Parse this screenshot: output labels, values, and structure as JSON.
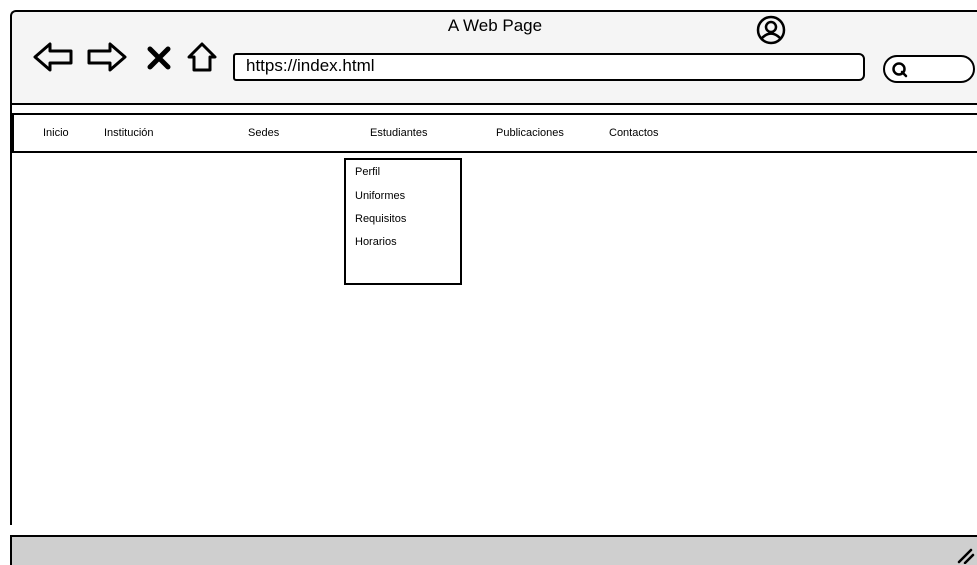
{
  "window": {
    "title": "A Web Page"
  },
  "toolbar": {
    "back_icon": "arrow-left-icon",
    "forward_icon": "arrow-right-icon",
    "stop_icon": "close-icon",
    "home_icon": "home-icon",
    "profile_icon": "user-circle-icon",
    "search_icon": "search-icon"
  },
  "address_bar": {
    "url": "https://index.html"
  },
  "search": {
    "value": ""
  },
  "menu": {
    "items": [
      {
        "label": "Inicio"
      },
      {
        "label": "Institución"
      },
      {
        "label": "Sedes"
      },
      {
        "label": "Estudiantes"
      },
      {
        "label": "Publicaciones"
      },
      {
        "label": "Contactos"
      }
    ],
    "open_item": "Estudiantes"
  },
  "dropdown": {
    "items": [
      {
        "label": "Perfil"
      },
      {
        "label": "Uniformes"
      },
      {
        "label": "Requisitos"
      },
      {
        "label": "Horarios"
      }
    ]
  },
  "colors": {
    "chrome": "#f5f5f5",
    "status_bar": "#cfcfcf",
    "stroke": "#000000"
  }
}
